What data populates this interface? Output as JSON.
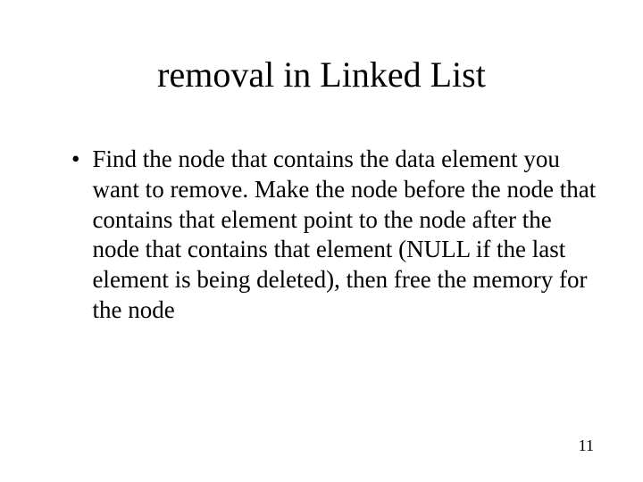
{
  "slide": {
    "title": "removal in Linked List",
    "bullet_marker": "•",
    "bullets": [
      "Find the node that contains the data element you want to remove.  Make the node before the node that contains that element point to the node after the node that contains that element (NULL if the last element is being deleted), then free the memory for the node"
    ],
    "page_number": "11"
  }
}
